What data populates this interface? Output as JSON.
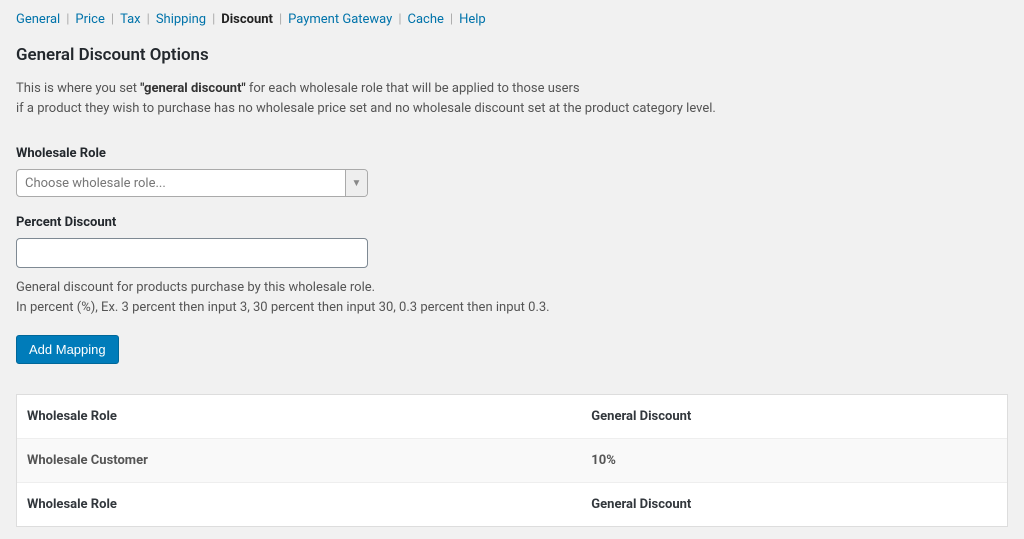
{
  "tabs": {
    "general": "General",
    "price": "Price",
    "tax": "Tax",
    "shipping": "Shipping",
    "discount": "Discount",
    "payment_gateway": "Payment Gateway",
    "cache": "Cache",
    "help": "Help"
  },
  "page_title": "General Discount Options",
  "description": {
    "line1_pre": "This is where you set ",
    "line1_bold": "\"general discount\"",
    "line1_post": " for each wholesale role that will be applied to those users",
    "line2": "if a product they wish to purchase has no wholesale price set and no wholesale discount set at the product category level."
  },
  "fields": {
    "wholesale_role_label": "Wholesale Role",
    "wholesale_role_placeholder": "Choose wholesale role...",
    "percent_discount_label": "Percent Discount",
    "percent_discount_value": "",
    "help_line1": "General discount for products purchase by this wholesale role.",
    "help_line2": "In percent (%), Ex. 3 percent then input 3, 30 percent then input 30, 0.3 percent then input 0.3."
  },
  "buttons": {
    "add_mapping": "Add Mapping"
  },
  "table": {
    "col_role": "Wholesale Role",
    "col_discount": "General Discount",
    "rows": [
      {
        "role": "Wholesale Customer",
        "discount": "10%"
      }
    ]
  }
}
